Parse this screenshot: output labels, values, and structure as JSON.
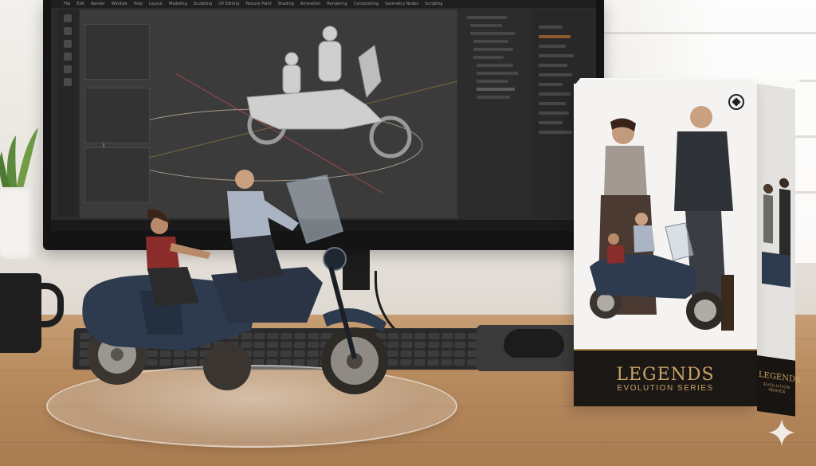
{
  "scene": {
    "description_visible": false
  },
  "monitor": {
    "menu_items": [
      "File",
      "Edit",
      "Render",
      "Window",
      "Help",
      "Layout",
      "Modeling",
      "Sculpting",
      "UV Editing",
      "Texture Paint",
      "Shading",
      "Animation",
      "Rendering",
      "Compositing",
      "Geometry Nodes",
      "Scripting"
    ]
  },
  "box": {
    "title": "LEGENDS",
    "subtitle": "EVOLUTION SERIES",
    "side_title": "LEGENDS",
    "side_subtitle": "EVOLUTION SERIES",
    "logo_icon": "diamond-circle-logo",
    "accent_color": "#c9a466",
    "band_color": "#1a1714"
  },
  "colors": {
    "motorcycle": "#2e3a4e",
    "screen_bg": "#2b2b2b",
    "desk": "#b88b5f"
  }
}
